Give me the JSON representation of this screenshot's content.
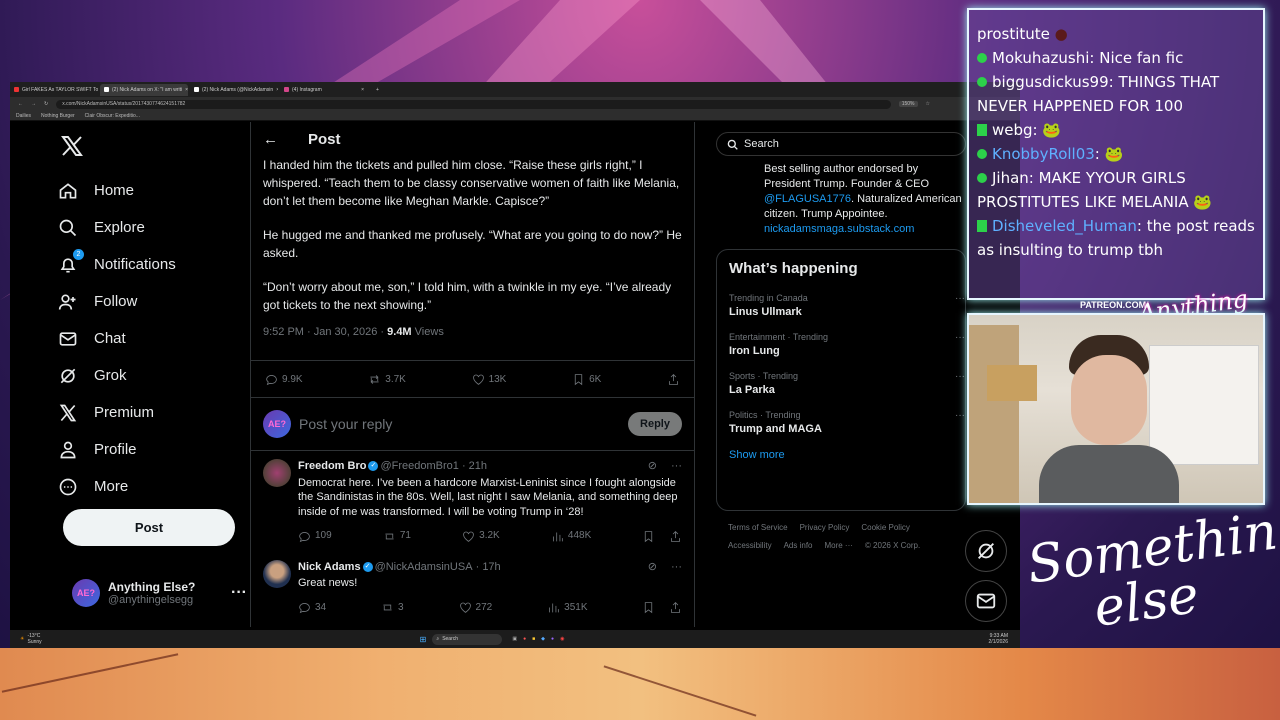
{
  "browser": {
    "tabs": [
      {
        "label": "Girl FAKES As TAYLOR SWIFT To",
        "color": "#e33"
      },
      {
        "label": "(2) Nick Adams on X: \"I am writi",
        "color": "#fff"
      },
      {
        "label": "(2) Nick Adams (@NickAdamsin",
        "color": "#fff"
      },
      {
        "label": "(4) Instagram",
        "color": "#d3468a"
      }
    ],
    "url": "x.com/NickAdamsinUSA/status/2017430774624151782",
    "zoom": "150%",
    "bookmarks": [
      "Dailies",
      "Nothing Burger",
      "Clair Obscur: Expeditio..."
    ]
  },
  "sidebar": {
    "items": [
      {
        "label": "Home",
        "icon": "home-icon"
      },
      {
        "label": "Explore",
        "icon": "search-icon"
      },
      {
        "label": "Notifications",
        "icon": "bell-icon",
        "badge": "2"
      },
      {
        "label": "Follow",
        "icon": "follow-icon"
      },
      {
        "label": "Chat",
        "icon": "mail-icon"
      },
      {
        "label": "Grok",
        "icon": "grok-icon"
      },
      {
        "label": "Premium",
        "icon": "x-icon"
      },
      {
        "label": "Profile",
        "icon": "person-icon"
      },
      {
        "label": "More",
        "icon": "more-circle-icon"
      }
    ],
    "post_label": "Post",
    "account": {
      "name": "Anything Else?",
      "handle": "@anythingelsegg",
      "avatar_text": "AE?"
    }
  },
  "post": {
    "header": "Post",
    "paragraphs": [
      "I handed him the tickets and pulled him close. “Raise these girls right,” I whispered. “Teach them to be classy conservative women of faith like Melania, don’t let them become like Meghan Markle. Capisce?”",
      "He hugged me and thanked me profusely. “What are you going to do now?” He asked.",
      "“Don’t worry about me, son,” I told him, with a twinkle in my eye. “I’ve already got tickets to the next showing.”"
    ],
    "time": "9:52 PM · Jan 30, 2026 ·",
    "views_count": "9.4M",
    "views_label": "Views",
    "stats": {
      "replies": "9.9K",
      "reposts": "3.7K",
      "likes": "13K",
      "bookmarks": "6K"
    },
    "reply_placeholder": "Post your reply",
    "reply_button": "Reply"
  },
  "replies": [
    {
      "name": "Freedom Bro",
      "handle": "@FreedomBro1",
      "time": "· 21h",
      "text": "Democrat here. I’ve been a hardcore Marxist-Leninist since I fought alongside the Sandinistas in the 80s. Well, last night I saw Melania, and something deep inside of me was transformed. I will be voting Trump in ‘28!",
      "stats": {
        "replies": "109",
        "reposts": "71",
        "likes": "3.2K",
        "views": "448K"
      }
    },
    {
      "name": "Nick Adams",
      "handle": "@NickAdamsinUSA",
      "time": "· 17h",
      "text": "Great news!",
      "stats": {
        "replies": "34",
        "reposts": "3",
        "likes": "272",
        "views": "351K"
      }
    }
  ],
  "right": {
    "search_placeholder": "Search",
    "bio_lines": [
      "Best selling author endorsed by",
      "President Trump. Founder & CEO"
    ],
    "bio_mention": "@FLAGUSA1776",
    "bio_rest": ". Naturalized American citizen. Trump Appointee.",
    "bio_link": "nickadamsmaga.substack.com",
    "happening_title": "What’s happening",
    "trends": [
      {
        "context": "Trending in Canada",
        "title": "Linus Ullmark"
      },
      {
        "context": "Entertainment · Trending",
        "title": "Iron Lung"
      },
      {
        "context": "Sports · Trending",
        "title": "La Parka"
      },
      {
        "context": "Politics · Trending",
        "title": "Trump and MAGA"
      }
    ],
    "show_more": "Show more",
    "footer": [
      "Terms of Service",
      "Privacy Policy",
      "Cookie Policy",
      "Accessibility",
      "Ads info",
      "More ···",
      "© 2026 X Corp."
    ]
  },
  "taskbar": {
    "weather_temp": "-13°C",
    "weather_label": "Sunny",
    "search": "Search",
    "time": "9:33 AM",
    "date": "2/1/2026"
  },
  "stream_chat": [
    {
      "user": "",
      "text": "prostitute",
      "badge": "none",
      "user_color": "#ffffff"
    },
    {
      "user": "Mokuhazushi",
      "text": ": Nice fan fic",
      "badge": "mod",
      "user_color": "#ffffff"
    },
    {
      "user": "biggusdickus99",
      "text": ": THINGS THAT NEVER HAPPENED FOR 100",
      "badge": "mod",
      "user_color": "#ffffff"
    },
    {
      "user": "webg",
      "text": ":",
      "badge": "kick",
      "user_color": "#ffffff"
    },
    {
      "user": "KnobbyRoll03",
      "text": ":",
      "badge": "mod",
      "user_color": "#5fb0ff"
    },
    {
      "user": "Jihan",
      "text": ": MAKE YYOUR GIRLS PROSTITUTES LIKE MELANIA",
      "badge": "mod",
      "user_color": "#ffffff"
    },
    {
      "user": "Disheveled_Human",
      "text": ": the post reads as insulting to trump tbh",
      "badge": "kick",
      "user_color": "#5fb0ff"
    }
  ],
  "overlay": {
    "patreon": "PATREON.COM/",
    "brand_small": "Anything else?",
    "brand_large_1": "Something",
    "brand_large_2": "else"
  }
}
